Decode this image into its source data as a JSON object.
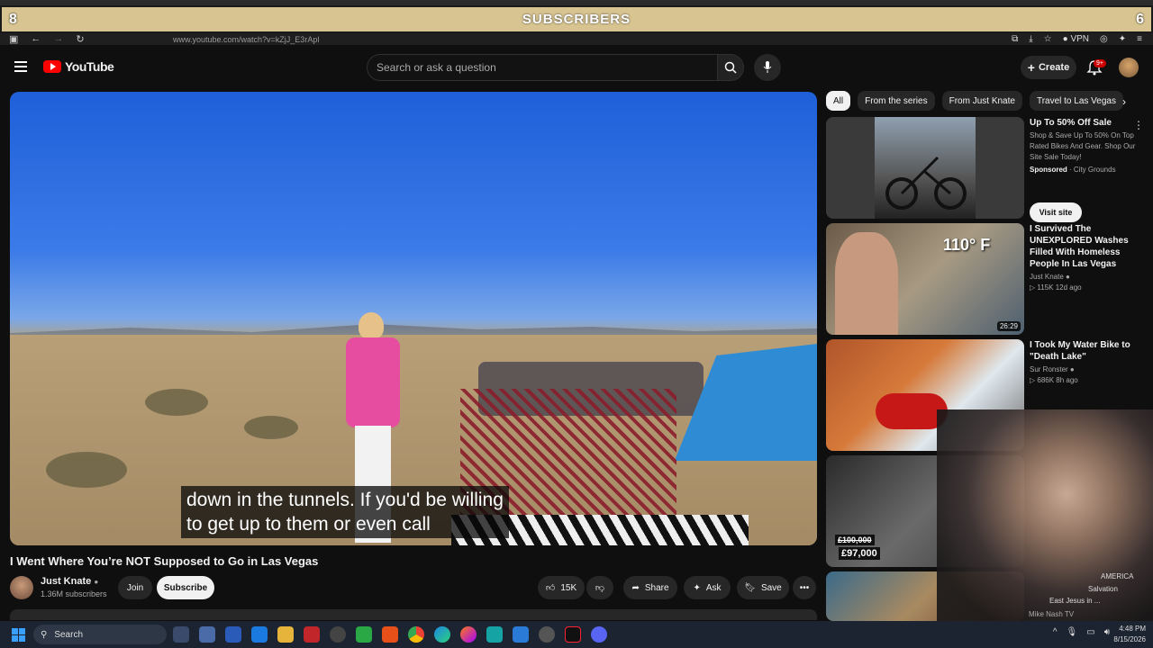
{
  "overlay": {
    "left_num": "8",
    "title": "SUBSCRIBERS",
    "right_num": "6"
  },
  "browser": {
    "url": "www.youtube.com/watch?v=kZjJ_E3rApl",
    "vpn_label": "VPN"
  },
  "header": {
    "logo_text": "YouTube",
    "search_placeholder": "Search or ask a question",
    "create_label": "Create",
    "notif_badge": "9+"
  },
  "video": {
    "caption_line1": "down in the tunnels. If you'd be willing",
    "caption_line2": "to get up to them or even call",
    "title": "I Went Where You’re NOT Supposed to Go in Las Vegas"
  },
  "channel": {
    "name": "Just Knate",
    "subs": "1.36M subscribers",
    "join_label": "Join",
    "subscribe_label": "Subscribe"
  },
  "actions": {
    "likes": "15K",
    "share_label": "Share",
    "ask_label": "Ask",
    "save_label": "Save"
  },
  "chips": [
    "All",
    "From the series",
    "From Just Knate",
    "Travel to Las Vegas"
  ],
  "ad": {
    "title": "Up To 50% Off Sale",
    "desc": "Shop & Save Up To 50% On Top Rated Bikes And Gear. Shop Our Site Sale Today!",
    "sponsored": "Sponsored",
    "advertiser": "City Grounds",
    "cta": "Visit site"
  },
  "recs": [
    {
      "title": "I Survived The UNEXPLORED Washes Filled With Homeless People In Las Vegas",
      "channel": "Just Knate",
      "meta": "115K  12d ago",
      "duration": "26:29",
      "thumb_text": "110° F"
    },
    {
      "title": "I Took My Water Bike to \"Death Lake\"",
      "channel": "Sur Ronster",
      "meta": "686K  8h ago"
    },
    {
      "price1": "£100,000",
      "price2": "£97,000"
    }
  ],
  "webcam_labels": {
    "l1": "AMERICA",
    "l2": "Salvation",
    "l3": "East Jesus in ...",
    "l4": "Mike Nash TV"
  },
  "taskbar": {
    "search_label": "Search",
    "time": "4:48 PM",
    "date": "8/15/2026"
  }
}
